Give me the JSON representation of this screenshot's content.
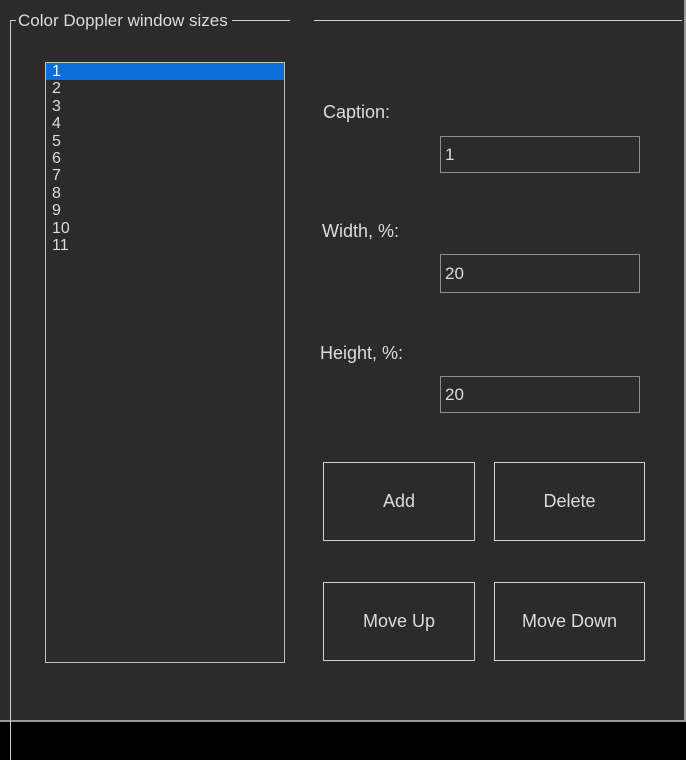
{
  "group": {
    "title": "Color Doppler window sizes"
  },
  "list": {
    "items": [
      "1",
      "2",
      "3",
      "4",
      "5",
      "6",
      "7",
      "8",
      "9",
      "10",
      "11"
    ],
    "selected_index": 0
  },
  "fields": {
    "caption_label": "Caption:",
    "caption_value": "1",
    "width_label": "Width, %:",
    "width_value": "20",
    "height_label": "Height, %:",
    "height_value": "20"
  },
  "buttons": {
    "add": "Add",
    "delete": "Delete",
    "move_up": "Move Up",
    "move_down": "Move Down"
  },
  "colors": {
    "background": "#2b2b2b",
    "selection": "#0a6fd8",
    "text": "#dcdcdc"
  }
}
